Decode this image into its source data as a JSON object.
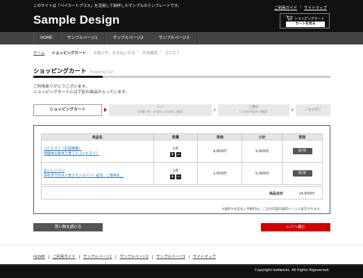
{
  "header": {
    "tagline": "このサイトは「ペイカートプラス」を活用して制作したサンプルのテンプレートです。",
    "logo": "Sample Design",
    "toplinks": [
      "ご利用ガイド",
      "サイトマップ"
    ],
    "cart_label": "ショッピングカート",
    "cart_button": "カートを見る"
  },
  "nav": {
    "items": [
      "HOME",
      "サンプルページ1",
      "サンプルページ2",
      "サンプルページ3"
    ]
  },
  "breadcrumb": {
    "home": "ホーム",
    "current": "ショッピングカート",
    "rest": [
      "お届け先・お支払い方法",
      "内容確認",
      "注文完了"
    ]
  },
  "page": {
    "title": "ショッピングカート",
    "subtitle": "Shopping Cart",
    "intro_line1": "ご利用ありがとうございます。",
    "intro_line2": "ショッピングカートには下記の商品が入っています。"
  },
  "steps": [
    {
      "label": "ショッピングカート",
      "sub": ""
    },
    {
      "label": "レジ",
      "sub": "(お届け先・お支払い方法のご指定)"
    },
    {
      "label": "ご確認",
      "sub": "(ご注文内容のご確認)"
    },
    {
      "label": "ご注文完了",
      "sub": ""
    }
  ],
  "table": {
    "headers": [
      "商品名",
      "数量",
      "単価",
      "小計",
      "削除"
    ],
    "rows": [
      {
        "name1": "コシヒカリ（お試価格）",
        "name2": "田園米の各米で育てたコシヒカリ！",
        "qty": "1点",
        "price": "9,800円",
        "subtotal": "9,800円",
        "delete": "削 除"
      },
      {
        "name1": "おいしいパン",
        "name2": "添ゆきでの大人気クランスパン！是非、ご賞味を。",
        "qty": "1点",
        "price": "2,500円",
        "subtotal": "5,000円",
        "delete": "削 除"
      }
    ],
    "total_label": "商品合計",
    "total_value": "14,800円",
    "note": "※送料やお支払い手数料は、ご注文内容の確認ページに表示されます。"
  },
  "buttons": {
    "continue": "買い物を続ける",
    "checkout": "レジへ進む"
  },
  "footer": {
    "links": [
      "HOME",
      "ご利用ガイド",
      "サンプルページ1",
      "サンプルページ2",
      "サンプルページ3",
      "サイトマップ"
    ],
    "copyright": "Copyright leafworks. All Rights Rigeserved."
  },
  "colors": {
    "header_bg": "#111111",
    "nav_bg": "#444444",
    "accent_red": "#cc0000",
    "link_blue": "#2a6fb0"
  }
}
